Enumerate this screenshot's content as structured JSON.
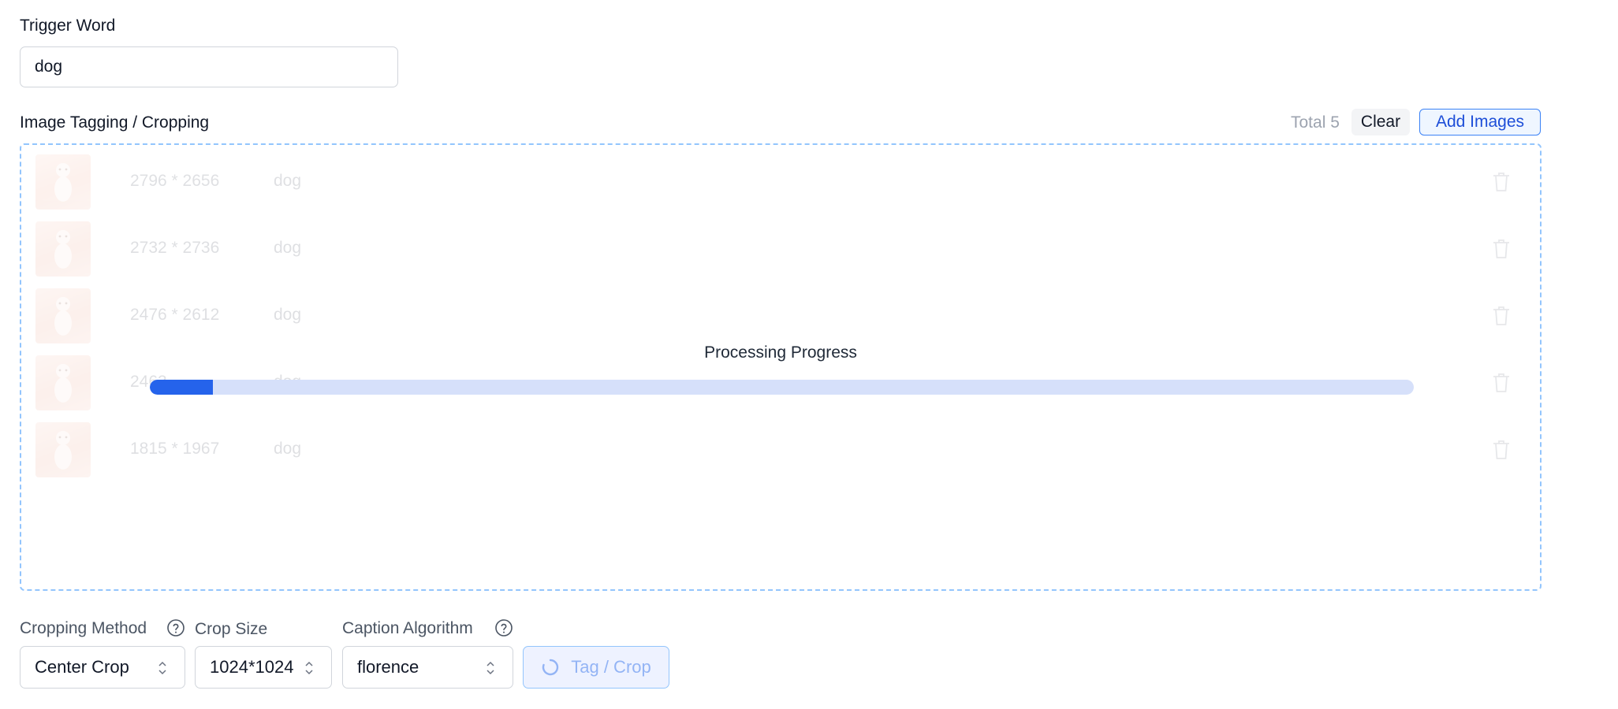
{
  "trigger": {
    "label": "Trigger Word",
    "value": "dog"
  },
  "tagging": {
    "title": "Image Tagging / Cropping",
    "total_label": "Total 5",
    "clear_label": "Clear",
    "add_label": "Add Images",
    "images": [
      {
        "dims": "2796 * 2656",
        "caption": "dog"
      },
      {
        "dims": "2732 * 2736",
        "caption": "dog"
      },
      {
        "dims": "2476 * 2612",
        "caption": "dog"
      },
      {
        "dims": "2463",
        "caption": "dog"
      },
      {
        "dims": "1815 * 1967",
        "caption": "dog"
      }
    ],
    "progress": {
      "title": "Processing Progress",
      "fraction": 0.05
    }
  },
  "controls": {
    "cropping_method": {
      "label": "Cropping Method",
      "value": "Center Crop"
    },
    "crop_size": {
      "label": "Crop Size",
      "value": "1024*1024"
    },
    "caption_algorithm": {
      "label": "Caption Algorithm",
      "value": "florence"
    },
    "tag_button": {
      "label": "Tag / Crop",
      "state": "loading"
    }
  },
  "colors": {
    "accent": "#2563eb",
    "progress_track": "#d6e0fa",
    "dropzone_border": "#93c5fd"
  },
  "icons": {
    "help": "question-circle-icon",
    "trash": "trash-icon",
    "chevron": "chevron-up-down-icon",
    "spinner": "spinner-icon"
  }
}
